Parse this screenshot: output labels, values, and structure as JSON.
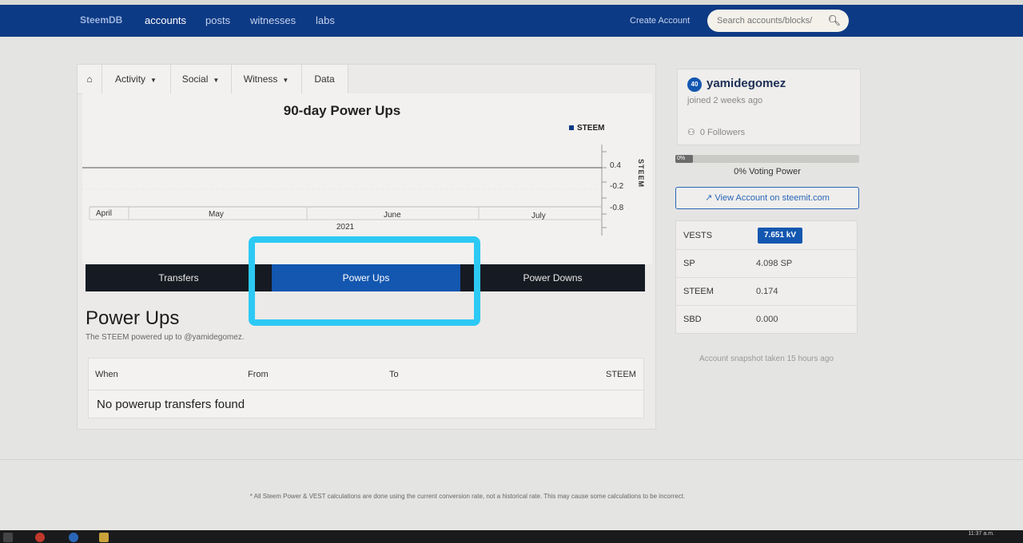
{
  "navbar": {
    "brand": "SteemDB",
    "links": [
      "accounts",
      "posts",
      "witnesses",
      "labs"
    ],
    "create_account": "Create Account",
    "search_placeholder": "Search accounts/blocks/"
  },
  "tabs": {
    "activity": "Activity",
    "social": "Social",
    "witness": "Witness",
    "data": "Data"
  },
  "chart_data": {
    "type": "line",
    "title": "90-day Power Ups",
    "series": [
      {
        "name": "STEEM",
        "values": [
          0,
          0,
          0,
          0
        ]
      }
    ],
    "categories": [
      "April",
      "May",
      "June",
      "July"
    ],
    "xlabel": "2021",
    "ylabel": "STEEM",
    "y_ticks": [
      "0.4",
      "-0.2",
      "-0.8"
    ],
    "legend": "top-right",
    "color": "#0d3a84"
  },
  "buttons": {
    "transfers": "Transfers",
    "power_ups": "Power Ups",
    "power_downs": "Power Downs"
  },
  "section": {
    "title": "Power Ups",
    "subtitle": "The STEEM powered up to @yamidegomez."
  },
  "table": {
    "columns": [
      "When",
      "From",
      "To",
      "STEEM"
    ],
    "empty_message": "No powerup transfers found"
  },
  "profile": {
    "reputation": "40",
    "username": "yamidegomez",
    "joined": "joined 2 weeks ago",
    "followers": "0 Followers"
  },
  "voting": {
    "bar_label": "0%",
    "power_label": "0% Voting Power",
    "percent": 0
  },
  "view_account": "View Account on steemit.com",
  "stats": {
    "vests_label": "VESTS",
    "vests_value": "7.651 kV",
    "sp_label": "SP",
    "sp_value": "4.098 SP",
    "steem_label": "STEEM",
    "steem_value": "0.174",
    "sbd_label": "SBD",
    "sbd_value": "0.000"
  },
  "snapshot": "Account snapshot taken 15 hours ago",
  "footnote": "* All Steem Power & VEST calculations are done using the current conversion rate, not a historical rate. This may cause some calculations to be incorrect.",
  "taskbar": {
    "clock": "11:37 a.m."
  },
  "colors": {
    "navbar": "#0d3a84",
    "active_button": "#1357b0",
    "highlight": "#2dc9f5"
  }
}
